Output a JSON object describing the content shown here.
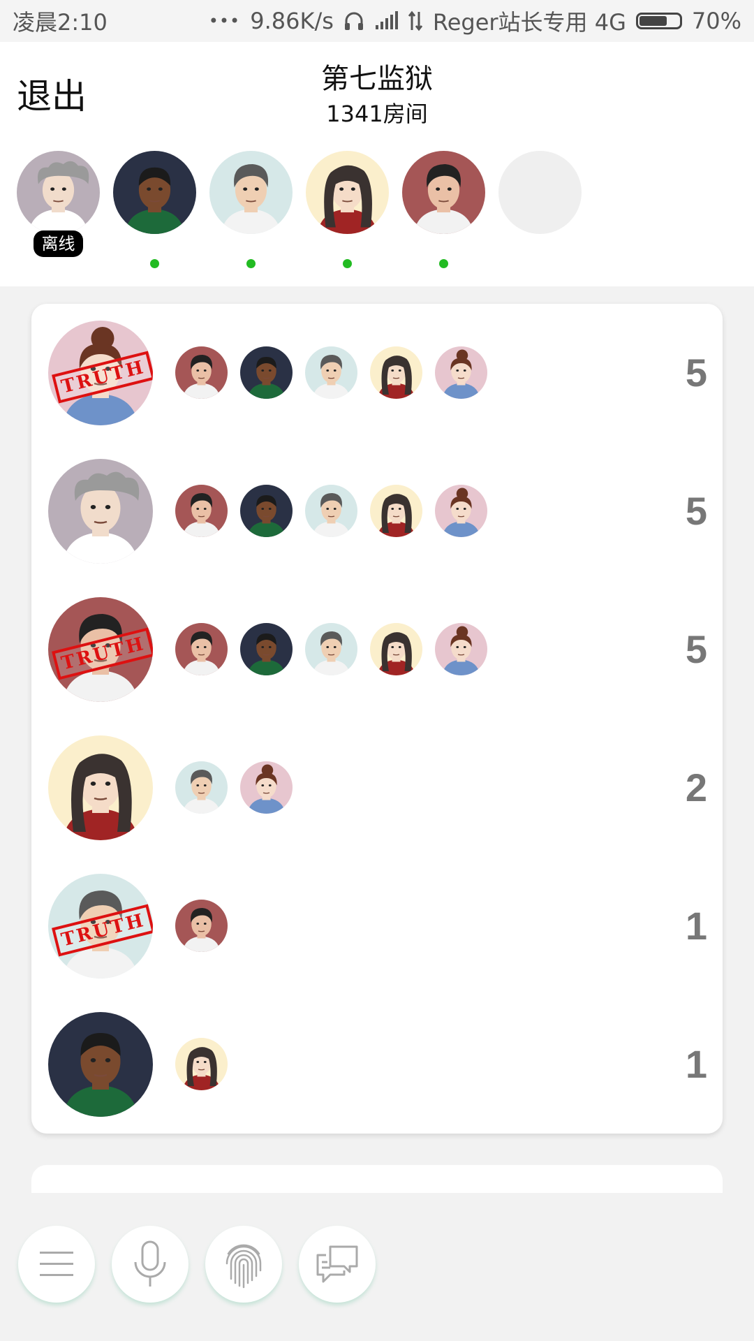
{
  "status_bar": {
    "time": "凌晨2:10",
    "dots": "•••",
    "speed": "9.86K/s",
    "carrier": "Reger站长专用 4G",
    "battery": "70%",
    "battery_level": 0.7
  },
  "header": {
    "exit_label": "退出",
    "title": "第七监狱",
    "subtitle": "1341房间",
    "offline_label": "离线"
  },
  "players": [
    {
      "avatar": "old-man",
      "status": "offline"
    },
    {
      "avatar": "dark-man",
      "status": "online"
    },
    {
      "avatar": "grey-hair-man",
      "status": "online"
    },
    {
      "avatar": "woman-dark-hair",
      "status": "online"
    },
    {
      "avatar": "young-man",
      "status": "online"
    },
    {
      "avatar": "empty",
      "status": "empty"
    }
  ],
  "stamp_text": "TRUTH",
  "votes": [
    {
      "target": "woman-bun",
      "stamped": true,
      "voters": [
        "young-man",
        "dark-man",
        "grey-hair-man",
        "woman-dark-hair",
        "woman-bun"
      ],
      "count": "5"
    },
    {
      "target": "old-man",
      "stamped": false,
      "voters": [
        "young-man",
        "dark-man",
        "grey-hair-man",
        "woman-dark-hair",
        "woman-bun"
      ],
      "count": "5"
    },
    {
      "target": "young-man",
      "stamped": true,
      "voters": [
        "young-man",
        "dark-man",
        "grey-hair-man",
        "woman-dark-hair",
        "woman-bun"
      ],
      "count": "5"
    },
    {
      "target": "woman-dark-hair",
      "stamped": false,
      "voters": [
        "grey-hair-man",
        "woman-bun"
      ],
      "count": "2"
    },
    {
      "target": "grey-hair-man",
      "stamped": true,
      "voters": [
        "young-man"
      ],
      "count": "1"
    },
    {
      "target": "dark-man",
      "stamped": false,
      "voters": [
        "woman-dark-hair"
      ],
      "count": "1"
    }
  ],
  "bottom_bar": {
    "buttons": [
      "menu-icon",
      "microphone-icon",
      "fingerprint-icon",
      "chat-icon"
    ]
  },
  "colors": {
    "online": "#22bb22",
    "stamp": "#dd1111",
    "count": "#777777",
    "button_glow": "#78c8aa"
  }
}
